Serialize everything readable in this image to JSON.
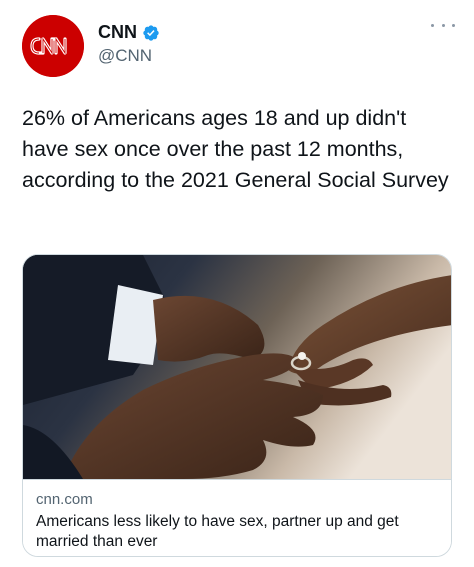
{
  "tweet": {
    "author": {
      "display_name": "CNN",
      "handle": "@CNN",
      "verified": true,
      "avatar_logo_text": "CNN",
      "avatar_color": "#cc0000"
    },
    "more_icon": "ellipsis-icon",
    "text": "26% of Americans ages 18 and up didn't have sex once over the past 12 months, according to the 2021 General Social Survey"
  },
  "card": {
    "image_description": "hands-placing-ring",
    "domain": "cnn.com",
    "title": "Americans less likely to have sex, partner up and get married than ever"
  },
  "colors": {
    "text_primary": "#0f1419",
    "text_secondary": "#536471",
    "verified_blue": "#1d9bf0",
    "border": "#cfd9de"
  }
}
